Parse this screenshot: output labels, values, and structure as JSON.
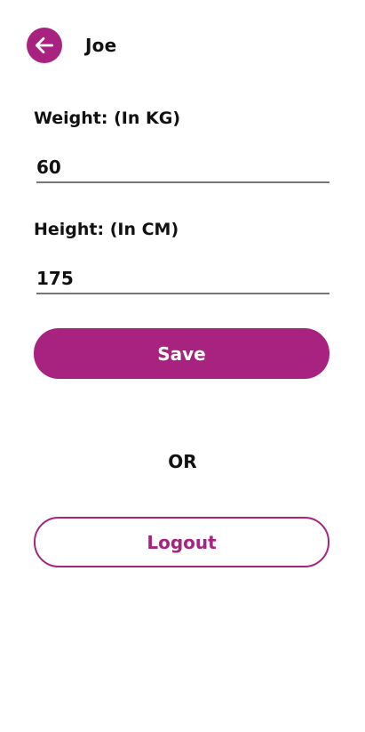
{
  "header": {
    "title": "Joe",
    "back_icon": "arrow-left-icon"
  },
  "form": {
    "weight_label": "Weight: (In KG)",
    "weight_value": "60",
    "height_label": "Height: (In CM)",
    "height_value": "175",
    "save_label": "Save"
  },
  "divider_text": "OR",
  "logout_label": "Logout",
  "colors": {
    "accent": "#a8237f",
    "text": "#111111",
    "underline": "#777777"
  }
}
